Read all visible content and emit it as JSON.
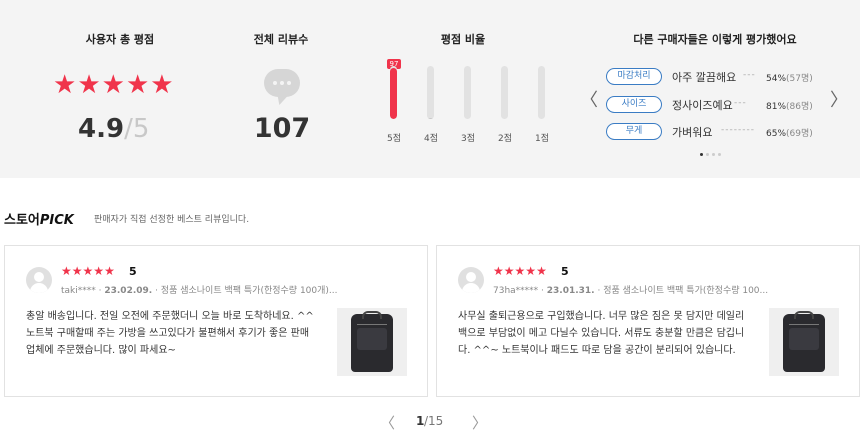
{
  "summary": {
    "rating_title": "사용자 총 평점",
    "average": "4.9",
    "average_max": "/5",
    "stars_filled": 5,
    "review_count_title": "전체 리뷰수",
    "review_count": "107",
    "ratio_title": "평점 비율",
    "ratio_highlight": "97",
    "ratio_bars": [
      {
        "label": "5점",
        "percent": 97
      },
      {
        "label": "4점",
        "percent": 2
      },
      {
        "label": "3점",
        "percent": 0
      },
      {
        "label": "2점",
        "percent": 0
      },
      {
        "label": "1점",
        "percent": 0
      }
    ],
    "keywords_title": "다른 구매자들은 이렇게 평가했어요",
    "keywords": [
      {
        "tag": "마감처리",
        "text": "아주 깔끔해요",
        "dash": "---",
        "percent": "54%",
        "count": "(57명)"
      },
      {
        "tag": "사이즈",
        "text": "정사이즈예요",
        "dash": "---",
        "percent": "81%",
        "count": "(86명)"
      },
      {
        "tag": "무게",
        "text": "가벼워요",
        "dash": "--------",
        "percent": "65%",
        "count": "(69명)"
      }
    ],
    "carousel_page": 1,
    "carousel_pages": 4
  },
  "store_pick": {
    "title_prefix": "스토어",
    "title_em": "PICK",
    "subtitle": "판매자가 직접 선정한 베스트 리뷰입니다."
  },
  "reviews": [
    {
      "score": "5",
      "user": "taki****",
      "date": "23.02.09.",
      "product": "정품 샘소나이트 백팩 특가(한정수량 100개)...",
      "body": "총알 배송입니다. 전일 오전에 주문했더니 오늘 바로 도착하네요. ^^ 노트북 구매할때 주는 가방을 쓰고있다가 불편해서 후기가 좋은 판매업체에 주문했습니다. 많이 파세요~"
    },
    {
      "score": "5",
      "user": "73ha*****",
      "date": "23.01.31.",
      "product": "정품 샘소나이트 백팩 특가(한정수량 100...",
      "body": "사무실 출퇴근용으로 구입했습니다. 너무 많은 짐은 못 담지만 데일리백으로 부담없이 메고 다닐수 있습니다. 서류도 충분할 만큼은 담깁니다. ^^~ 노트북이나 패드도 따로 담을 공간이 분리되어 있습니다."
    }
  ],
  "pager": {
    "current": "1",
    "total": "/15"
  },
  "colors": {
    "accent": "#f0344b",
    "tag_blue": "#3a7cc4",
    "panel_bg": "#f4f4f4"
  }
}
